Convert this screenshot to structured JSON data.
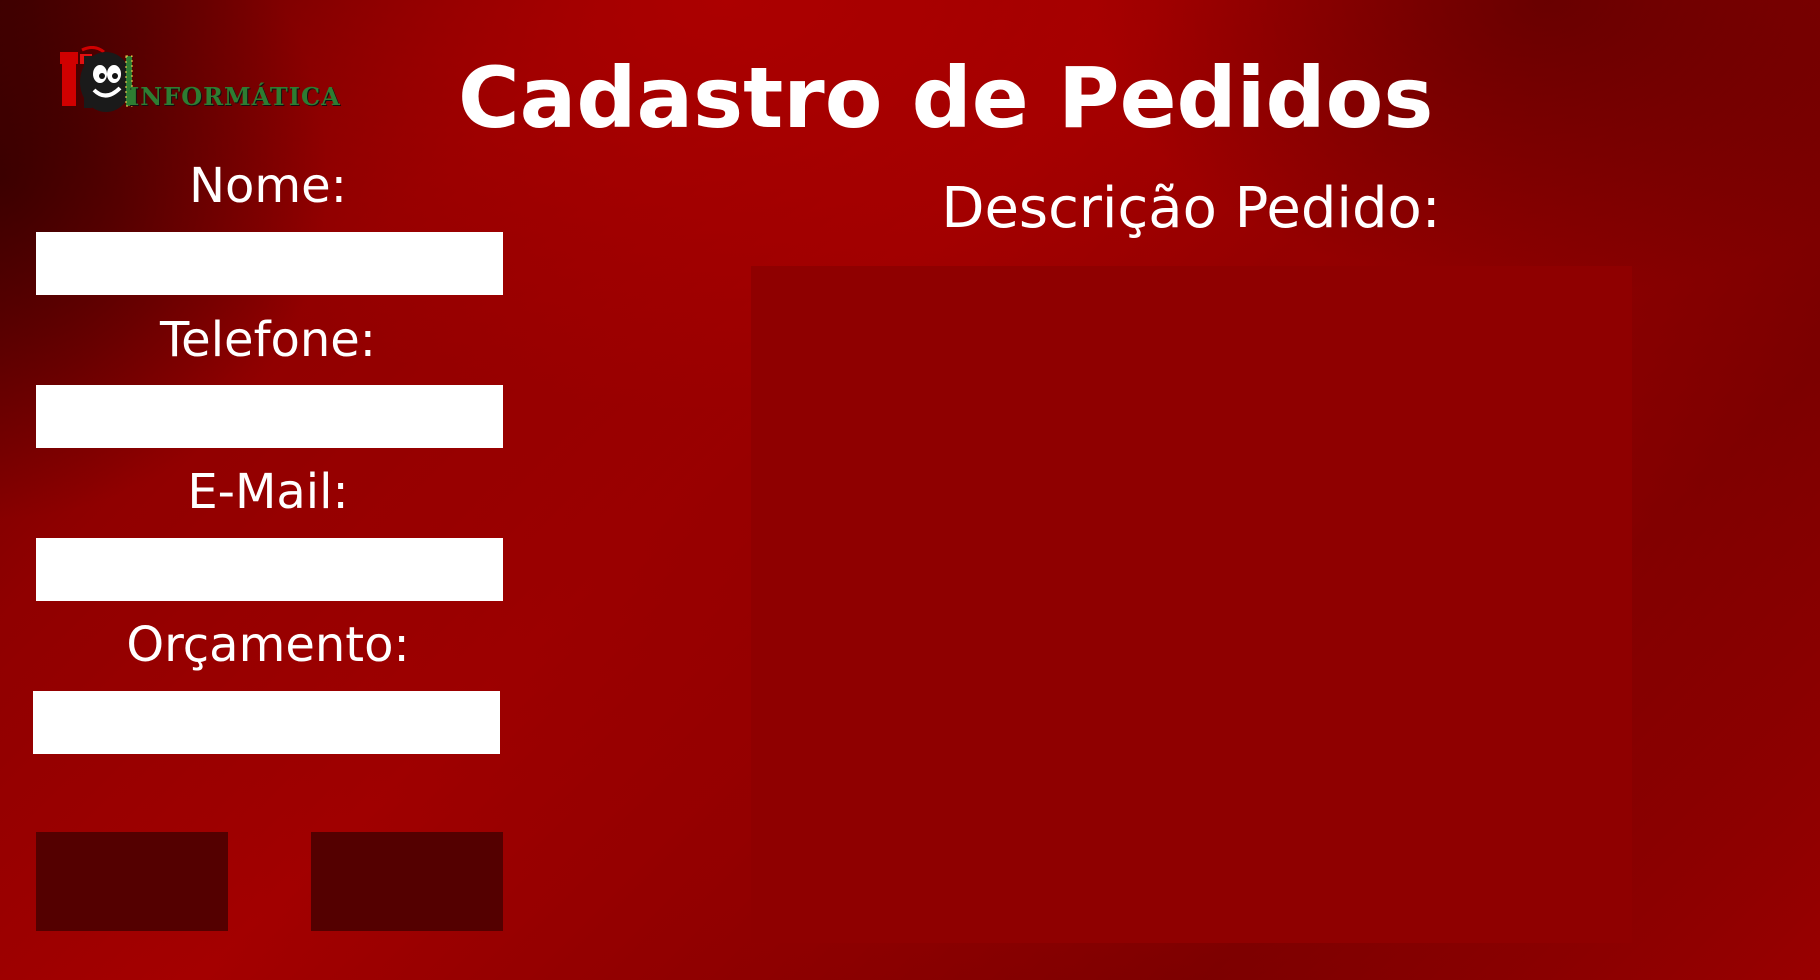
{
  "header": {
    "title": "Cadastro de Pedidos",
    "logo": {
      "text": "INFORMÁTICA",
      "icon": "mascot-logo-icon"
    }
  },
  "form": {
    "fields": [
      {
        "label": "Nome:",
        "value": "",
        "placeholder": ""
      },
      {
        "label": "Telefone:",
        "value": "",
        "placeholder": ""
      },
      {
        "label": "E-Mail:",
        "value": "",
        "placeholder": ""
      },
      {
        "label": "Orçamento:",
        "value": "",
        "placeholder": ""
      }
    ],
    "description": {
      "label": "Descrição Pedido:",
      "value": "",
      "placeholder": ""
    },
    "buttons": [
      {
        "label": ""
      },
      {
        "label": ""
      }
    ]
  },
  "colors": {
    "background": "#9a0000",
    "description_area": "#8f0000",
    "buttons": "#540000",
    "text": "#ffffff",
    "inputs": "#ffffff"
  }
}
